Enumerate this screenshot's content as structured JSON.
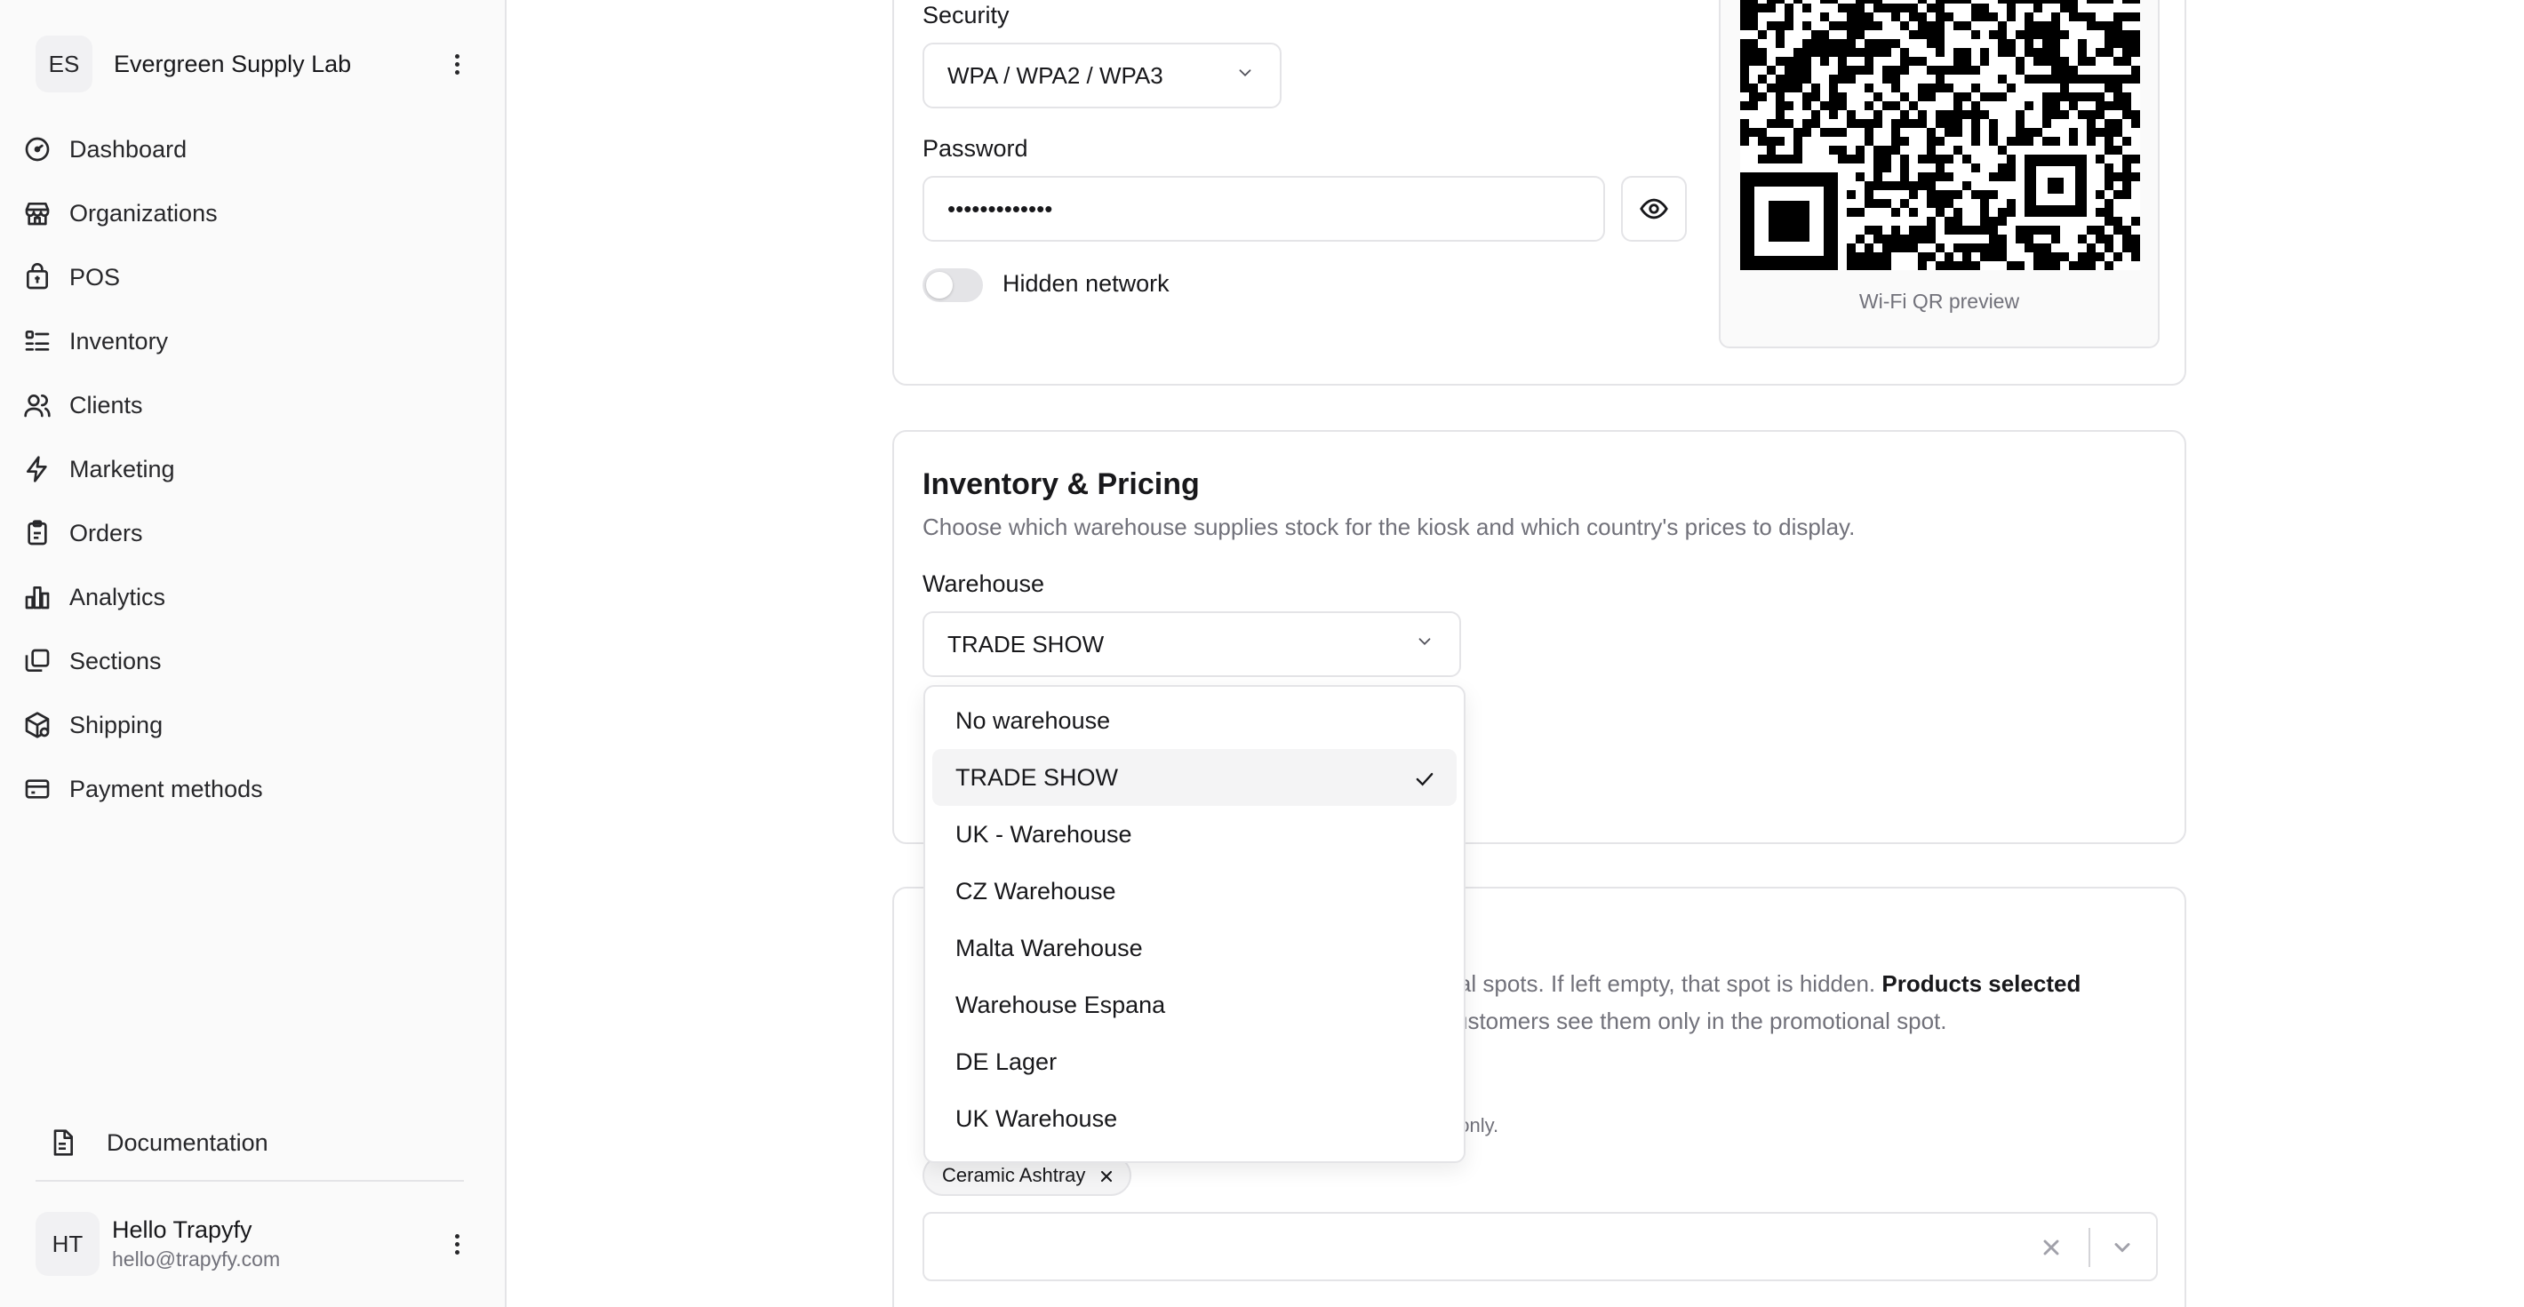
{
  "sidebar": {
    "org": {
      "initials": "ES",
      "name": "Evergreen Supply Lab"
    },
    "items": [
      {
        "label": "Dashboard",
        "icon": "gauge-icon"
      },
      {
        "label": "Organizations",
        "icon": "store-icon"
      },
      {
        "label": "POS",
        "icon": "bag-icon"
      },
      {
        "label": "Inventory",
        "icon": "list-icon"
      },
      {
        "label": "Clients",
        "icon": "users-icon"
      },
      {
        "label": "Marketing",
        "icon": "zap-icon"
      },
      {
        "label": "Orders",
        "icon": "clipboard-icon"
      },
      {
        "label": "Analytics",
        "icon": "bar-chart-icon"
      },
      {
        "label": "Sections",
        "icon": "layers-icon"
      },
      {
        "label": "Shipping",
        "icon": "package-icon"
      },
      {
        "label": "Payment methods",
        "icon": "wallet-icon"
      }
    ],
    "documentation": "Documentation",
    "user": {
      "initials": "HT",
      "name": "Hello Trapyfy",
      "email": "hello@trapyfy.com"
    }
  },
  "wifi": {
    "security_label": "Security",
    "security_value": "WPA / WPA2 / WPA3",
    "password_label": "Password",
    "password_value": "•••••••••••••",
    "hidden_network_label": "Hidden network",
    "hidden_network_on": false,
    "qr_caption": "Wi-Fi QR preview"
  },
  "inventory": {
    "title": "Inventory & Pricing",
    "description": "Choose which warehouse supplies stock for the kiosk and which country's prices to display.",
    "warehouse_label": "Warehouse",
    "warehouse_value": "TRADE SHOW",
    "options": [
      "No warehouse",
      "TRADE SHOW",
      "UK - Warehouse",
      "CZ Warehouse",
      "Malta Warehouse",
      "Warehouse Espana",
      "DE Lager",
      "UK Warehouse"
    ],
    "selected_index": 1
  },
  "products": {
    "desc_part1": "onal spots. If left empty, that spot is hidden. ",
    "desc_bold": "Products selected",
    "desc_part2": "customers see them only in the promotional spot.",
    "hint": "ct only.",
    "chip_label": "Ceramic Ashtray"
  }
}
